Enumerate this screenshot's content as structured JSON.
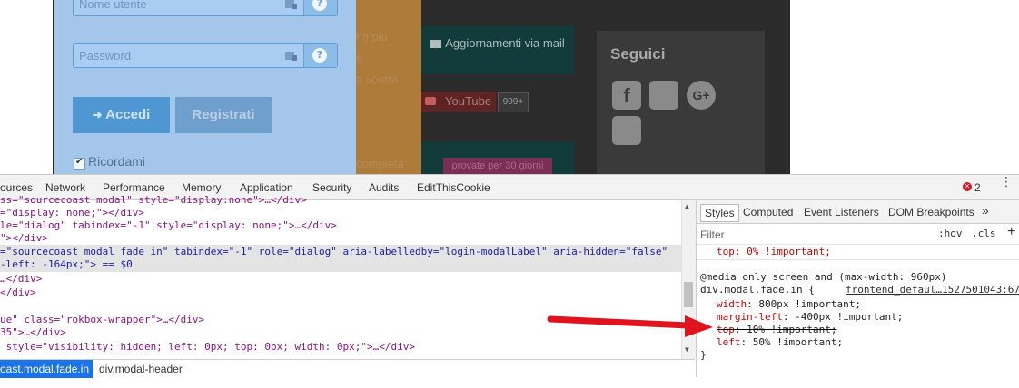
{
  "login": {
    "username_placeholder": "Nome utente",
    "password_placeholder": "Password",
    "login_button": "Accedi",
    "register_button": "Registrati",
    "remember_label": "Ricordami"
  },
  "website": {
    "newsletter_tile": "Aggiornamenti via mail",
    "youtube_label": "YouTube",
    "youtube_count": "999+",
    "follow_heading": "Seguici",
    "faded_lines": [
      "nti più",
      "e",
      "a vostra",
      "completa"
    ],
    "promo_text": "provate per 30 giorni"
  },
  "devtools": {
    "tabs": [
      "ources",
      "Network",
      "Performance",
      "Memory",
      "Application",
      "Security",
      "Audits",
      "EditThisCookie"
    ],
    "error_count": "2",
    "elements_lines": [
      "ss=\"sourcecoast modal\" style=\"display:none\">…</div>",
      "=\"display: none;\"></div>",
      "le=\"dialog\" tabindex=\"-1\" style=\"display: none;\">…</div>",
      "\"></div>",
      "=\"sourcecoast modal fade in\" tabindex=\"-1\" role=\"dialog\" aria-labelledby=\"login-modalLabel\" aria-hidden=\"false\"",
      "-left: -164px;\"> == $0",
      "…</div>",
      "</div>",
      "",
      "ue\" class=\"rokbox-wrapper\">…</div>",
      "35\">…</div>",
      " style=\"visibility: hidden; left: 0px; top: 0px; width: 0px;\">…</div>"
    ],
    "breadcrumbs": [
      "oast.modal.fade.in",
      "div.modal-header"
    ],
    "styles_tabs": [
      "Styles",
      "Computed",
      "Event Listeners",
      "DOM Breakpoints"
    ],
    "styles_more": "»",
    "filter_placeholder": "Filter",
    "hov_label": ":hov",
    "cls_label": ".cls",
    "add_rule": "+",
    "rules": {
      "prev_line": "top: 0% !important;",
      "media": "@media only screen and (max-width: 960px)",
      "selector": "div.modal.fade.in {",
      "source": "frontend_defaul…1527501043:67",
      "decls": [
        {
          "prop": "width",
          "val": "800px !important;",
          "struck": false
        },
        {
          "prop": "margin-left",
          "val": "-400px !important;",
          "struck": false
        },
        {
          "prop": "top",
          "val": "10% !important;",
          "struck": true
        },
        {
          "prop": "left",
          "val": "50% !important;",
          "struck": false
        }
      ],
      "close": "}"
    }
  },
  "colors": {
    "arrow": "#e0141e",
    "modal_bg": "#a8cbf2",
    "highlight_row": "#e4e4e4",
    "crumb_active": "#1a73e8"
  }
}
